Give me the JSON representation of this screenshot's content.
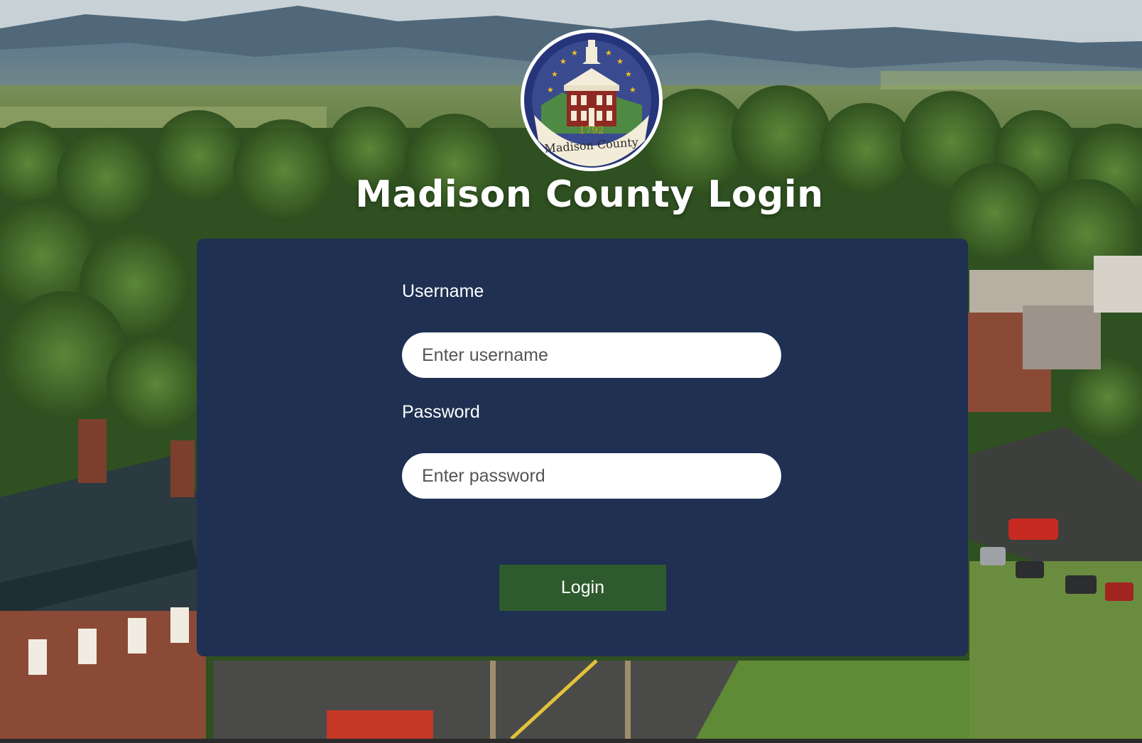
{
  "page": {
    "title": "Madison County Login"
  },
  "seal": {
    "year": "1792",
    "name": "Madison County",
    "colors": {
      "ring": "#26357a",
      "sky": "#3a4a8f",
      "star": "#f2c21a",
      "courthouse": "#8e2a22",
      "banner": "#f3ecd8"
    }
  },
  "form": {
    "username_label": "Username",
    "username_placeholder": "Enter username",
    "password_label": "Password",
    "password_placeholder": "Enter password",
    "login_label": "Login"
  },
  "colors": {
    "card_background": "#1f3052",
    "login_button": "#2e5b2d",
    "title_text": "#ffffff"
  }
}
